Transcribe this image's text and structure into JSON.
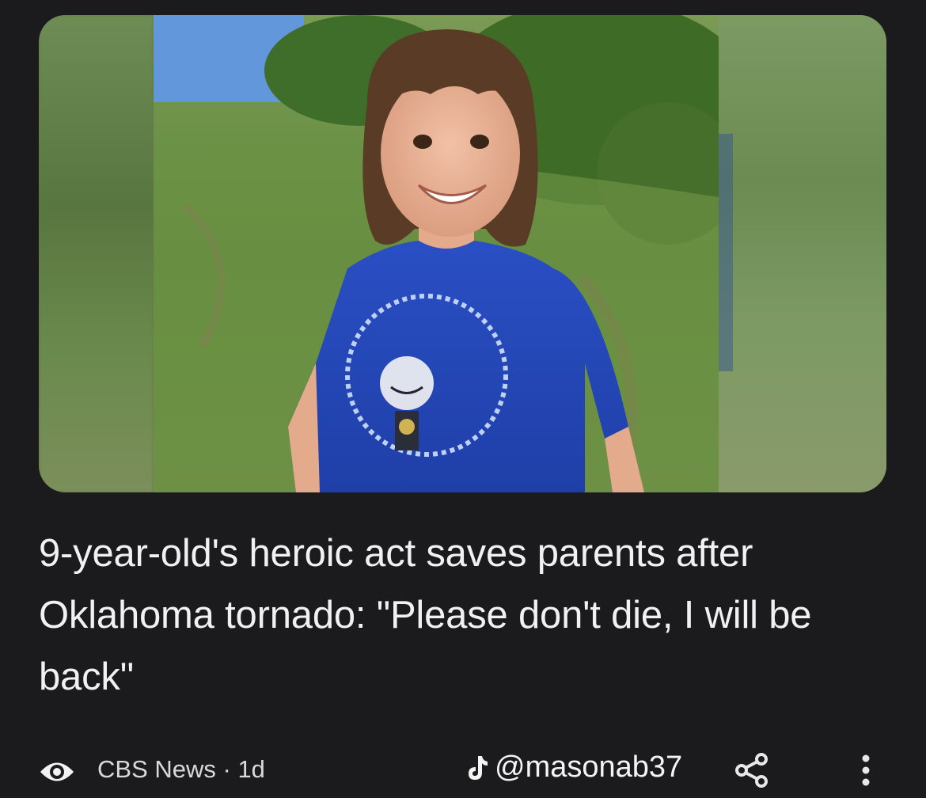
{
  "article": {
    "headline": "9-year-old's heroic act saves parents after Oklahoma tornado: \"Please don't die, I will be back\"",
    "image_description_icon": "news-photo",
    "source": {
      "name": "CBS News",
      "age": "1d",
      "separator": " · ",
      "icon": "cbs-eye-icon"
    }
  },
  "watermark": {
    "platform_icon": "tiktok-note-icon",
    "handle": "@masonab37"
  },
  "actions": {
    "share_icon": "share-icon",
    "more_icon": "more-vertical-icon"
  },
  "colors": {
    "background": "#1b1b1d",
    "text": "#f1f1f1",
    "secondary_text": "#d9d9d9"
  }
}
